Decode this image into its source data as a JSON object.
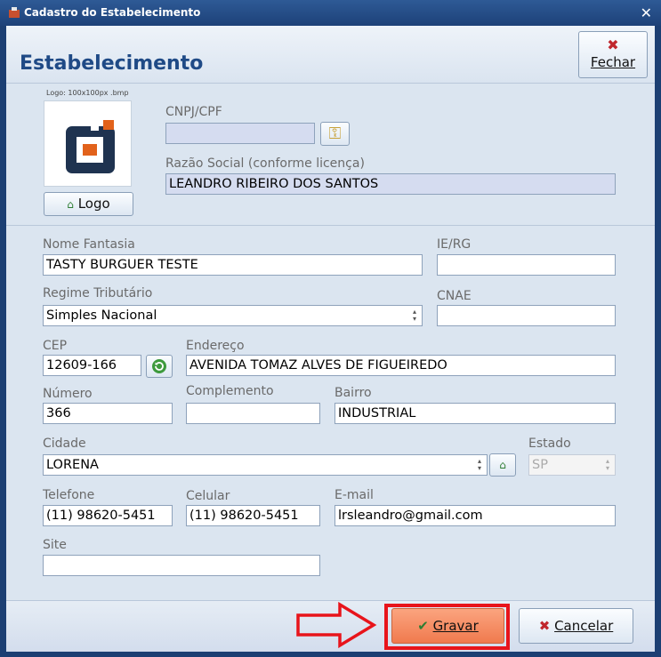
{
  "window": {
    "title": "Cadastro do Estabelecimento"
  },
  "header": {
    "title": "Estabelecimento",
    "close_label": "Fechar"
  },
  "logo": {
    "caption": "Logo: 100x100px .bmp",
    "button_label": "Logo"
  },
  "fields": {
    "cnpj": {
      "label": "CNPJ/CPF",
      "value": ""
    },
    "razao": {
      "label": "Razão Social (conforme licença)",
      "value": "LEANDRO RIBEIRO DOS SANTOS"
    },
    "nome_fantasia": {
      "label": "Nome Fantasia",
      "value": "TASTY BURGUER TESTE"
    },
    "ie_rg": {
      "label": "IE/RG",
      "value": ""
    },
    "regime": {
      "label": "Regime Tributário",
      "value": "Simples Nacional"
    },
    "cnae": {
      "label": "CNAE",
      "value": ""
    },
    "cep": {
      "label": "CEP",
      "value": "12609-166"
    },
    "endereco": {
      "label": "Endereço",
      "value": "AVENIDA TOMAZ ALVES DE FIGUEIREDO"
    },
    "numero": {
      "label": "Número",
      "value": "366"
    },
    "complemento": {
      "label": "Complemento",
      "value": ""
    },
    "bairro": {
      "label": "Bairro",
      "value": "INDUSTRIAL"
    },
    "cidade": {
      "label": "Cidade",
      "value": "LORENA"
    },
    "estado": {
      "label": "Estado",
      "value": "SP"
    },
    "telefone": {
      "label": "Telefone",
      "value": "(11) 98620-5451"
    },
    "celular": {
      "label": "Celular",
      "value": "(11) 98620-5451"
    },
    "email": {
      "label": "E-mail",
      "value": "lrsleandro@gmail.com"
    },
    "site": {
      "label": "Site",
      "value": ""
    }
  },
  "footer": {
    "save_label": "Gravar",
    "cancel_label": "Cancelar"
  },
  "colors": {
    "titlebar": "#1d4178",
    "accent_title": "#1f4a86",
    "save_button": "#f58d63",
    "highlight": "#e8141b"
  },
  "icons": {
    "close": "x-icon",
    "key": "key-icon",
    "refresh": "refresh-icon",
    "check": "check-icon"
  }
}
